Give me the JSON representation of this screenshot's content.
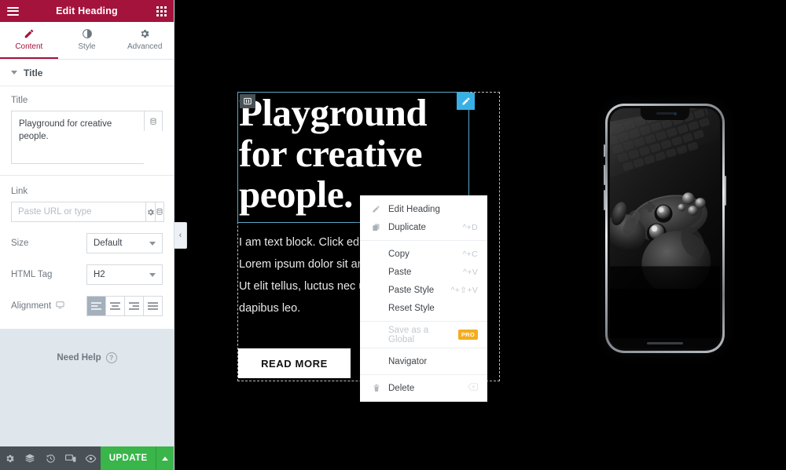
{
  "panel": {
    "header": {
      "title": "Edit Heading",
      "menu_icon": "hamburger-icon",
      "apps_icon": "apps-grid-icon"
    },
    "tabs": [
      {
        "label": "Content",
        "icon": "pencil-icon",
        "active": true
      },
      {
        "label": "Style",
        "icon": "contrast-circle-icon",
        "active": false
      },
      {
        "label": "Advanced",
        "icon": "gear-icon",
        "active": false
      }
    ],
    "section": {
      "label": "Title",
      "collapse_icon": "caret-down-icon"
    },
    "controls": {
      "title_label": "Title",
      "title_value": "Playground for creative people.",
      "title_dynamic_icon": "database-icon",
      "link_label": "Link",
      "link_placeholder": "Paste URL or type",
      "link_value": "",
      "link_options_icon": "gear-icon",
      "link_dynamic_icon": "database-icon",
      "size_label": "Size",
      "size_value": "Default",
      "html_tag_label": "HTML Tag",
      "html_tag_value": "H2",
      "alignment_label": "Alignment",
      "alignment_device_icon": "desktop-icon",
      "alignment_options": [
        "align-left",
        "align-center",
        "align-right",
        "align-justify"
      ],
      "alignment_selected": "align-left"
    },
    "need_help": {
      "label": "Need Help",
      "icon": "question-circle-icon"
    },
    "footer": {
      "icons": [
        "settings-gear-icon",
        "layers-icon",
        "history-clock-icon",
        "responsive-mode-icon",
        "preview-eye-icon"
      ],
      "update_label": "UPDATE",
      "update_caret_icon": "caret-up-icon"
    },
    "collapse_handle": {
      "icon": "chevron-left-icon",
      "glyph": "‹"
    }
  },
  "canvas": {
    "column_handle_icon": "column-handle-icon",
    "edit_handle_icon": "pencil-edit-icon",
    "heading": "Playground for creative people.",
    "text_block_lines": [
      "I am text block. Click edit butt",
      "Lorem ipsum dolor sit amet, c",
      "Ut elit tellus, luctus nec ullame",
      "dapibus leo."
    ],
    "read_more_label": "READ MORE"
  },
  "context_menu": {
    "groups": [
      [
        {
          "label": "Edit Heading",
          "shortcut": "",
          "icon": "pencil-icon",
          "disabled": false
        },
        {
          "label": "Duplicate",
          "shortcut": "^+D",
          "icon": "duplicate-icon",
          "disabled": false
        }
      ],
      [
        {
          "label": "Copy",
          "shortcut": "^+C",
          "icon": "",
          "disabled": false
        },
        {
          "label": "Paste",
          "shortcut": "^+V",
          "icon": "",
          "disabled": false
        },
        {
          "label": "Paste Style",
          "shortcut": "^+⇧+V",
          "icon": "",
          "disabled": false
        },
        {
          "label": "Reset Style",
          "shortcut": "",
          "icon": "",
          "disabled": false
        }
      ],
      [
        {
          "label": "Save as a Global",
          "shortcut": "",
          "badge": "PRO",
          "icon": "",
          "disabled": true
        }
      ],
      [
        {
          "label": "Navigator",
          "shortcut": "",
          "icon": "",
          "disabled": false
        }
      ],
      [
        {
          "label": "Delete",
          "shortcut": "",
          "icon": "trash-icon",
          "trailing_icon": "delete-key-icon",
          "disabled": false
        }
      ]
    ]
  },
  "phone_mockup": {
    "device": "iPhone X",
    "wallpaper_description": "grayscale photo of hands holding a game controller over a keyboard",
    "notch_icon": "phone-notch",
    "home_indicator_icon": "home-indicator"
  },
  "colors": {
    "brand_crimson": "#a4133c",
    "panel_bg": "#f1f3f5",
    "panel_footer": "#495157",
    "update_green": "#39b54a",
    "edit_handle_blue": "#39b0e5",
    "pro_badge": "#f3ad1d",
    "canvas_bg": "#000000"
  }
}
